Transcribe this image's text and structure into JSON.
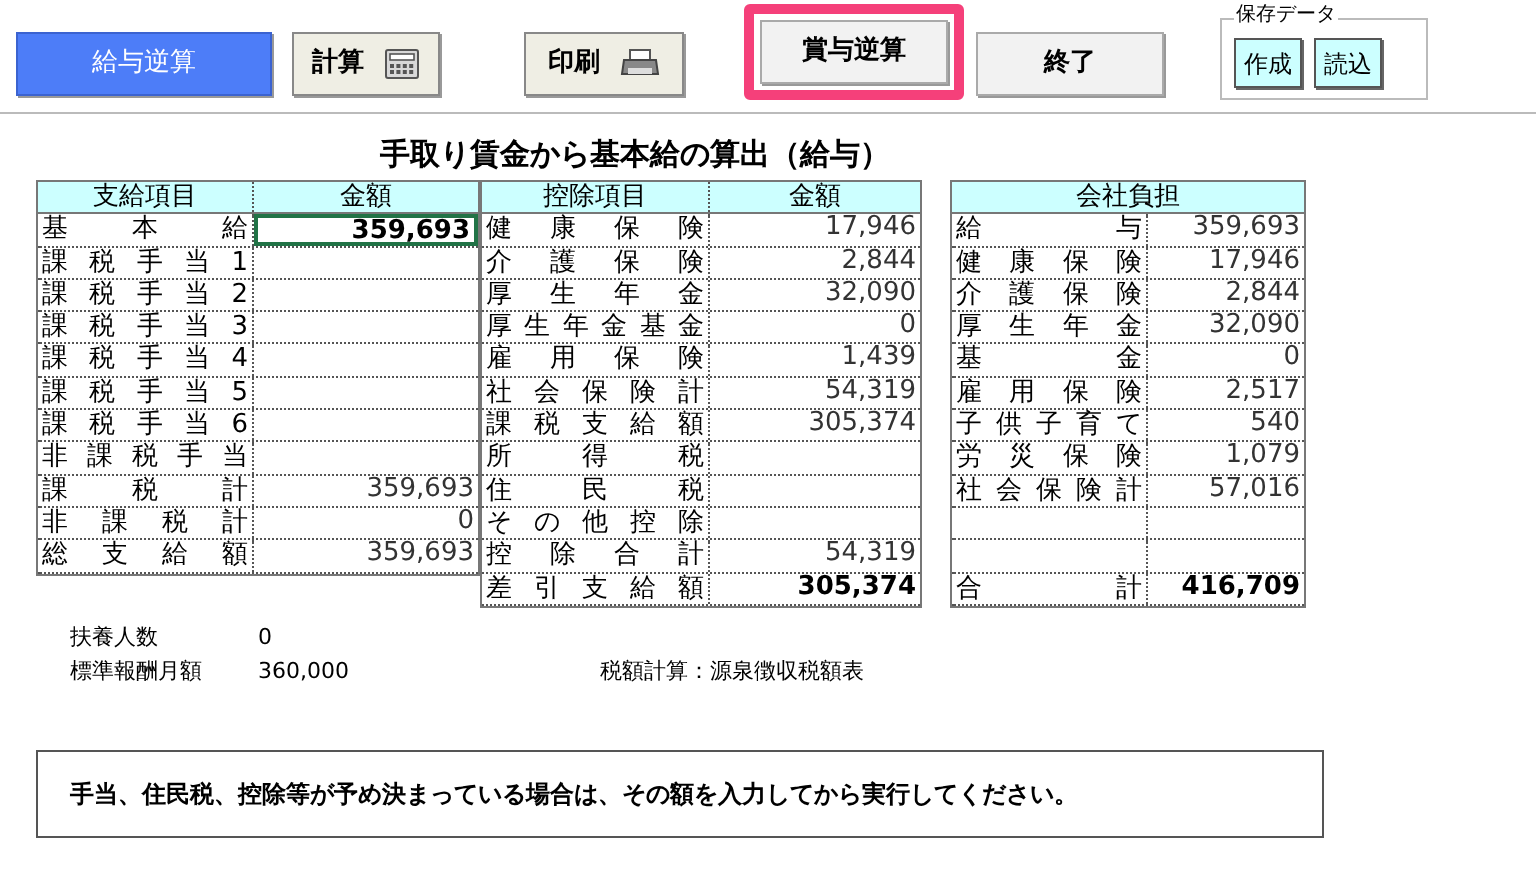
{
  "toolbar": {
    "buttons": [
      {
        "label": "給与逆算",
        "kind": "primary",
        "highlighted": false
      },
      {
        "label": "計算",
        "kind": "calculator",
        "highlighted": false
      },
      {
        "label": "印刷",
        "kind": "printer",
        "highlighted": false
      },
      {
        "label": "賞与逆算",
        "kind": "plain",
        "highlighted": true
      },
      {
        "label": "終了",
        "kind": "plain",
        "highlighted": false
      }
    ],
    "save_data": {
      "title": "保存データ",
      "buttons": [
        "作成",
        "読込"
      ]
    }
  },
  "title": "手取り賃金から基本給の算出（給与）",
  "payments": {
    "columns": [
      "支給項目",
      "金額"
    ],
    "rows": [
      {
        "label": "基　　本　　給",
        "amount": "359,693",
        "bold": true,
        "selected": true
      },
      {
        "label": "課税手当1",
        "selected": false
      },
      {
        "label": "課税手当2",
        "selected": false
      },
      {
        "label": "課税手当3",
        "selected": false
      },
      {
        "label": "課税手当4",
        "selected": false
      },
      {
        "label": "課税手当5",
        "selected": false
      },
      {
        "label": "課税手当6",
        "selected": false
      },
      {
        "label": "非課税手当",
        "selected": false
      },
      {
        "label": "課　税　計",
        "amount": "359,693",
        "bold": false,
        "selected": false
      },
      {
        "label": "非課税計",
        "amount": "0",
        "bold": false,
        "selected": false
      },
      {
        "label": "総支給額",
        "amount": "359,693",
        "bold": false,
        "selected": false
      }
    ]
  },
  "deductions": {
    "columns": [
      "控除項目",
      "金額"
    ],
    "rows": [
      {
        "label": "健康保険",
        "amount": "17,946",
        "bold": false
      },
      {
        "label": "介護保険",
        "amount": "2,844",
        "bold": false
      },
      {
        "label": "厚生年金",
        "amount": "32,090",
        "bold": false
      },
      {
        "label": "厚生年金基金",
        "amount": "0",
        "bold": false
      },
      {
        "label": "雇用保険",
        "amount": "1,439",
        "bold": false
      },
      {
        "label": "社会保険計",
        "amount": "54,319",
        "bold": false
      },
      {
        "label": "課税支給額",
        "amount": "305,374",
        "bold": false
      },
      {
        "label": "所　得　税"
      },
      {
        "label": "住　民　税"
      },
      {
        "label": "その他控除"
      },
      {
        "label": "控除合計",
        "amount": "54,319",
        "bold": false
      },
      {
        "label": "差引支給額",
        "amount": "305,374",
        "bold": true
      }
    ]
  },
  "company_burden": {
    "title": "会社負担",
    "rows": [
      {
        "label": "給　　　与",
        "amount": "359,693",
        "bold": false
      },
      {
        "label": "健康保険",
        "amount": "17,946",
        "bold": false
      },
      {
        "label": "介護保険",
        "amount": "2,844",
        "bold": false
      },
      {
        "label": "厚生年金",
        "amount": "32,090",
        "bold": false
      },
      {
        "label": "基　　　金",
        "amount": "0",
        "bold": false
      },
      {
        "label": "雇用保険",
        "amount": "2,517",
        "bold": false
      },
      {
        "label": "子供子育て",
        "amount": "540",
        "bold": false
      },
      {
        "label": "労災保険",
        "amount": "1,079",
        "bold": false
      },
      {
        "label": "社会保険計",
        "amount": "57,016",
        "bold": false
      },
      {},
      {},
      {
        "label": "合　　　計",
        "amount": "416,709",
        "bold": true
      }
    ]
  },
  "info": [
    {
      "label": "扶養人数",
      "value": "0"
    },
    {
      "label": "標準報酬月額",
      "value": "360,000"
    }
  ],
  "tax_method": "税額計算：源泉徴収税額表",
  "note": "手当、住民税、控除等が予め決まっている場合は、その額を入力してから実行してください。"
}
